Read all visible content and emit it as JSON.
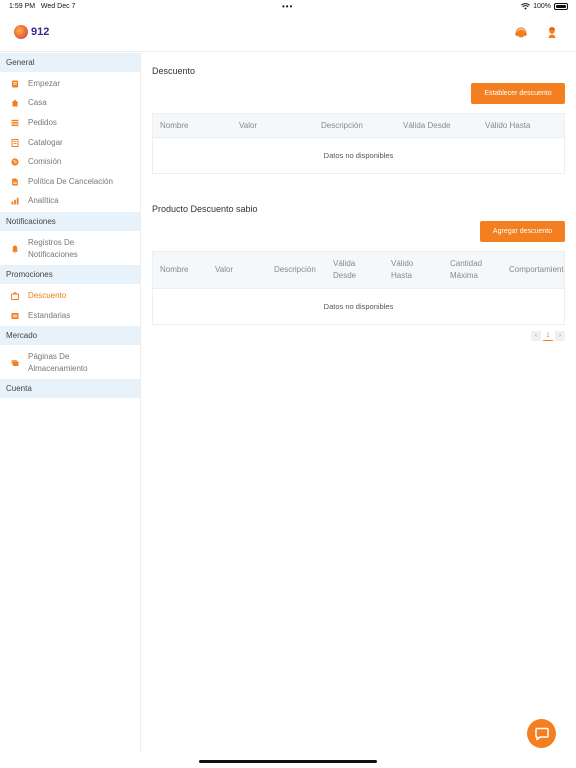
{
  "status": {
    "time": "1:59 PM",
    "date": "Wed Dec 7",
    "dots": "•••",
    "battery": "100%"
  },
  "header": {
    "logo_text": "912",
    "brand_color": "#f47f20"
  },
  "sidebar": {
    "sections": [
      {
        "title": "General",
        "items": [
          {
            "label": "Empezar",
            "icon": "start-icon"
          },
          {
            "label": "Casa",
            "icon": "home-icon"
          },
          {
            "label": "Pedidos",
            "icon": "orders-icon"
          },
          {
            "label": "Catalogar",
            "icon": "catalog-icon"
          },
          {
            "label": "Comisión",
            "icon": "commission-icon"
          },
          {
            "label": "Política De Cancelación",
            "icon": "document-icon"
          },
          {
            "label": "Analítica",
            "icon": "analytics-icon"
          }
        ]
      },
      {
        "title": "Notificaciones",
        "items": [
          {
            "label": "Registros De Notificaciones",
            "icon": "bell-icon"
          }
        ]
      },
      {
        "title": "Promociones",
        "items": [
          {
            "label": "Descuento",
            "icon": "discount-icon",
            "active": true
          },
          {
            "label": "Estandarias",
            "icon": "banner-icon"
          }
        ]
      },
      {
        "title": "Mercado",
        "items": [
          {
            "label": "Páginas De Almacenamiento",
            "icon": "store-pages-icon"
          }
        ]
      },
      {
        "title": "Cuenta",
        "items": []
      }
    ]
  },
  "discount": {
    "title": "Descuento",
    "button": "Establecer descuento",
    "columns": [
      "Nombre",
      "Valor",
      "Descripción",
      "Válida Desde",
      "Válido Hasta"
    ],
    "empty": "Datos no disponibles"
  },
  "product_discount": {
    "title": "Producto Descuento sabio",
    "button": "Agregar descuento",
    "columns": [
      "Nombre",
      "Valor",
      "Descripción",
      "Válida Desde",
      "Válido Hasta",
      "Cantidad Máxima",
      "Comportamiento"
    ],
    "empty": "Datos no disponibles"
  },
  "pagination": {
    "prev": "‹",
    "current": "1",
    "next": "›"
  }
}
